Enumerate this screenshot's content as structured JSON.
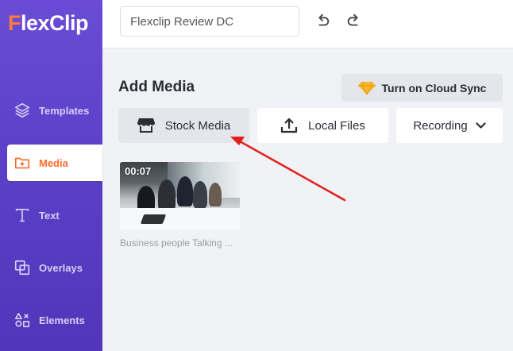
{
  "app": {
    "logo_text": "FlexClip"
  },
  "sidebar": {
    "items": [
      {
        "label": "Templates",
        "icon": "layers-icon",
        "active": false
      },
      {
        "label": "Media",
        "icon": "folder-plus-icon",
        "active": true
      },
      {
        "label": "Text",
        "icon": "text-icon",
        "active": false
      },
      {
        "label": "Overlays",
        "icon": "overlays-icon",
        "active": false
      },
      {
        "label": "Elements",
        "icon": "shapes-icon",
        "active": false
      }
    ]
  },
  "topbar": {
    "project_title": "Flexclip Review DC",
    "undo_icon": "undo-icon",
    "redo_icon": "redo-icon"
  },
  "panel": {
    "title": "Add Media",
    "cloud_sync_label": "Turn on Cloud Sync",
    "sources": {
      "stock": "Stock Media",
      "local": "Local Files",
      "recording": "Recording"
    }
  },
  "media": [
    {
      "duration": "00:07",
      "name": "Business people Talking ..."
    }
  ],
  "colors": {
    "sidebar": "#5b3fc8",
    "accent": "#ff6a2c",
    "annotation_arrow": "#e02020",
    "gem": "#f5b82e"
  }
}
